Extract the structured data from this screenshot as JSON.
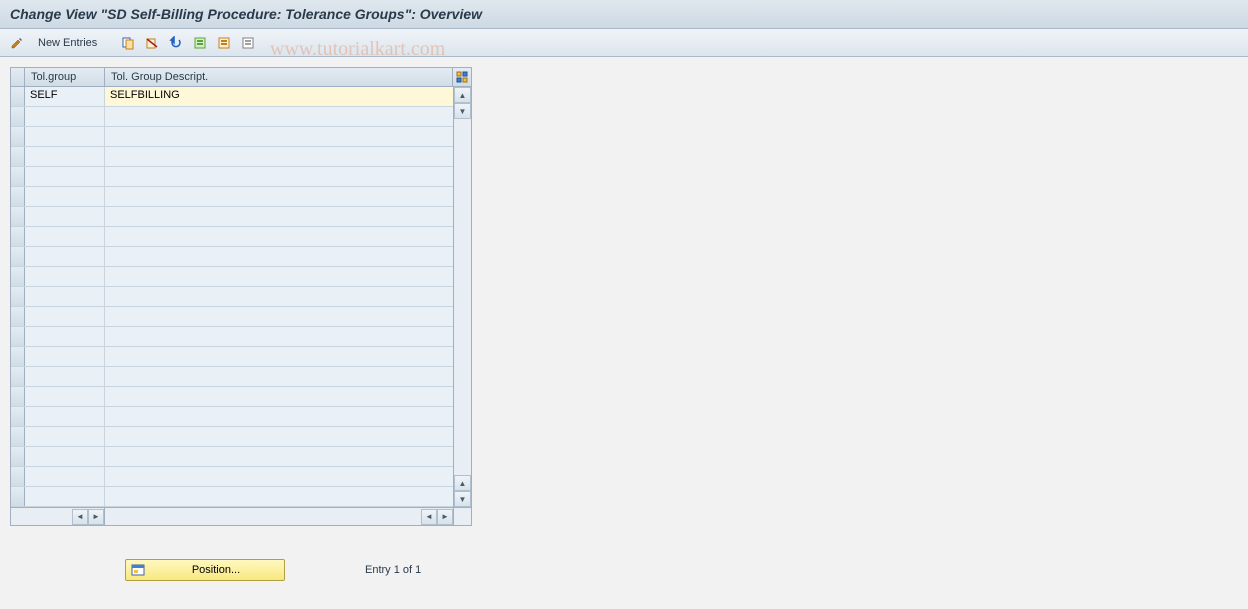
{
  "header": {
    "title": "Change View \"SD Self-Billing Procedure: Tolerance Groups\": Overview"
  },
  "toolbar": {
    "new_entries_label": "New Entries"
  },
  "watermark": "www.tutorialkart.com",
  "table": {
    "columns": {
      "tol_group": "Tol.group",
      "tol_group_descript": "Tol. Group Descript."
    },
    "rows": [
      {
        "tol_group": "SELF",
        "descript": "SELFBILLING"
      },
      {
        "tol_group": "",
        "descript": ""
      },
      {
        "tol_group": "",
        "descript": ""
      },
      {
        "tol_group": "",
        "descript": ""
      },
      {
        "tol_group": "",
        "descript": ""
      },
      {
        "tol_group": "",
        "descript": ""
      },
      {
        "tol_group": "",
        "descript": ""
      },
      {
        "tol_group": "",
        "descript": ""
      },
      {
        "tol_group": "",
        "descript": ""
      },
      {
        "tol_group": "",
        "descript": ""
      },
      {
        "tol_group": "",
        "descript": ""
      },
      {
        "tol_group": "",
        "descript": ""
      },
      {
        "tol_group": "",
        "descript": ""
      },
      {
        "tol_group": "",
        "descript": ""
      },
      {
        "tol_group": "",
        "descript": ""
      },
      {
        "tol_group": "",
        "descript": ""
      },
      {
        "tol_group": "",
        "descript": ""
      },
      {
        "tol_group": "",
        "descript": ""
      },
      {
        "tol_group": "",
        "descript": ""
      },
      {
        "tol_group": "",
        "descript": ""
      },
      {
        "tol_group": "",
        "descript": ""
      }
    ]
  },
  "footer": {
    "position_label": "Position...",
    "entry_text": "Entry 1 of 1"
  }
}
